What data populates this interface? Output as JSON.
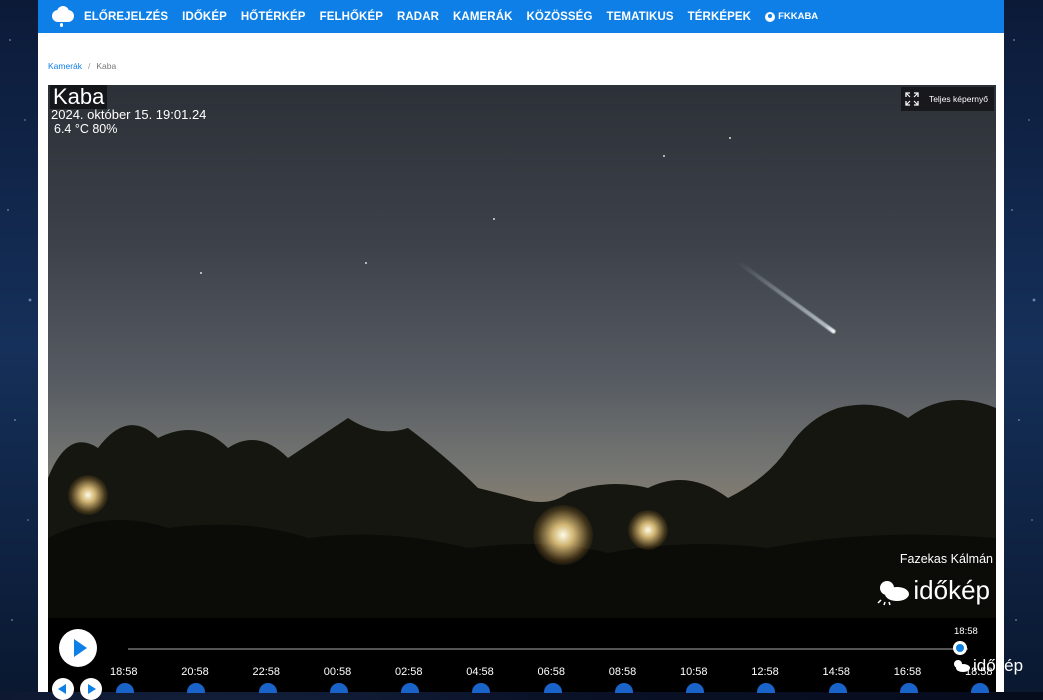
{
  "nav": {
    "items": [
      "ELŐREJELZÉS",
      "IDŐKÉP",
      "HŐTÉRKÉP",
      "FELHŐKÉP",
      "RADAR",
      "KAMERÁK",
      "KÖZÖSSÉG",
      "TEMATIKUS",
      "TÉRKÉPEK"
    ],
    "user": "FKKABA"
  },
  "breadcrumb": {
    "parent": "Kamerák",
    "current": "Kaba"
  },
  "camera": {
    "name": "Kaba",
    "datetime": "2024. október 15. 19:01.24",
    "weather": "6.4 °C 80%",
    "fullscreen_label": "Teljes képernyő",
    "credit": "Fazekas Kálmán",
    "watermark": "időkép"
  },
  "timeline": {
    "current_label": "18:58",
    "progress": 0.99,
    "ticks": [
      "18:58",
      "20:58",
      "22:58",
      "00:58",
      "02:58",
      "04:58",
      "06:58",
      "08:58",
      "10:58",
      "12:58",
      "14:58",
      "16:58",
      "18:58"
    ]
  },
  "corner_watermark": "időkép",
  "colors": {
    "brand_blue": "#0d7fe6",
    "white": "#ffffff"
  }
}
